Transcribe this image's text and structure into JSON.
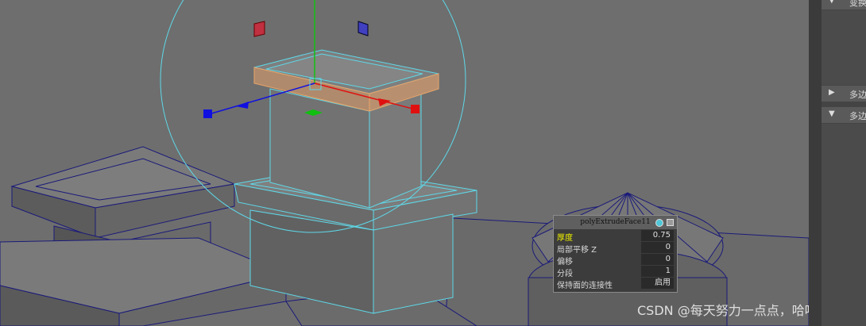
{
  "side_panel": {
    "rows": [
      {
        "arrow": "▼",
        "label": "变换"
      },
      {
        "arrow": "▶",
        "label": "多边"
      },
      {
        "arrow": "▼",
        "label": "多边"
      }
    ]
  },
  "channel_box": {
    "title": "polyExtrudeFace11",
    "attributes": [
      {
        "name": "厚度",
        "value": "0.75",
        "selected": true
      },
      {
        "name": "局部平移 Z",
        "value": "0"
      },
      {
        "name": "偏移",
        "value": "0"
      },
      {
        "name": "分段",
        "value": "1"
      },
      {
        "name": "保持面的连接性",
        "value": "启用"
      }
    ]
  },
  "watermark": "CSDN @每天努力一点点，哈哈",
  "colors": {
    "viewport_bg": "#6e6e6e",
    "wire": "#1a1a7a",
    "selection_wire": "#5ed8e8",
    "selected_face": "#e8a56a",
    "gizmo_x": "#e01010",
    "gizmo_y": "#10c010",
    "gizmo_z": "#1010e0"
  }
}
